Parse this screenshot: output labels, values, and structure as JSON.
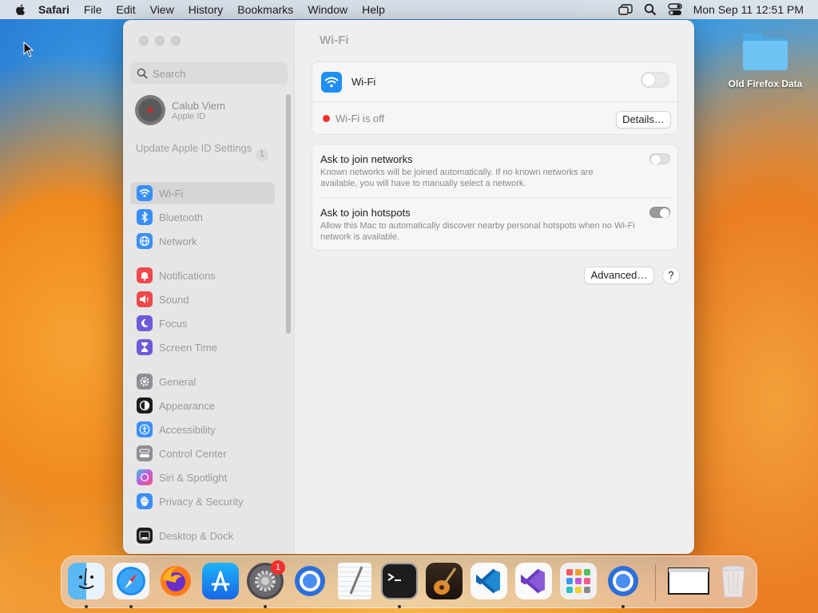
{
  "menubar": {
    "app_name": "Safari",
    "items": [
      "File",
      "Edit",
      "View",
      "History",
      "Bookmarks",
      "Window",
      "Help"
    ],
    "clock": "Mon Sep 11  12:51 PM"
  },
  "desktop": {
    "folder_label": "Old Firefox Data"
  },
  "window": {
    "search_placeholder": "Search",
    "account": {
      "name": "Calub Viem",
      "subtitle": "Apple ID"
    },
    "update": {
      "label": "Update Apple ID Settings",
      "badge": "1"
    },
    "sidebar": {
      "items": [
        {
          "label": "Wi-Fi",
          "icon": "wifi-icon",
          "color": "#3a8ff7",
          "active": true
        },
        {
          "label": "Bluetooth",
          "icon": "bluetooth-icon",
          "color": "#3a8ff7"
        },
        {
          "label": "Network",
          "icon": "network-globe-icon",
          "color": "#3a8ff7"
        },
        {
          "label": "Notifications",
          "icon": "bell-icon",
          "color": "#f0484a"
        },
        {
          "label": "Sound",
          "icon": "speaker-icon",
          "color": "#f0484a"
        },
        {
          "label": "Focus",
          "icon": "moon-icon",
          "color": "#6e5ad8"
        },
        {
          "label": "Screen Time",
          "icon": "hourglass-icon",
          "color": "#6e5ad8"
        },
        {
          "label": "General",
          "icon": "gear-icon",
          "color": "#8e8e93"
        },
        {
          "label": "Appearance",
          "icon": "appearance-icon",
          "color": "#1d1d1f"
        },
        {
          "label": "Accessibility",
          "icon": "accessibility-icon",
          "color": "#3a8ff7"
        },
        {
          "label": "Control Center",
          "icon": "control-center-icon",
          "color": "#8e8e93"
        },
        {
          "label": "Siri & Spotlight",
          "icon": "siri-icon",
          "color": "#c45bd8"
        },
        {
          "label": "Privacy & Security",
          "icon": "hand-icon",
          "color": "#3a8ff7"
        },
        {
          "label": "Desktop & Dock",
          "icon": "dock-icon",
          "color": "#1d1d1f"
        }
      ]
    },
    "main": {
      "title": "Wi-Fi",
      "wifi_label": "Wi-Fi",
      "wifi_on": false,
      "status_text": "Wi-Fi is off",
      "details_button": "Details…",
      "ask_networks": {
        "title": "Ask to join networks",
        "description": "Known networks will be joined automatically. If no known networks are available, you will have to manually select a network.",
        "on": false
      },
      "ask_hotspots": {
        "title": "Ask to join hotspots",
        "description": "Allow this Mac to automatically discover nearby personal hotspots when no Wi-Fi network is available.",
        "on": true
      },
      "advanced_button": "Advanced…",
      "help_button": "?"
    }
  },
  "dock": {
    "apps": [
      "Finder",
      "Safari",
      "Firefox",
      "App Store",
      "System Settings",
      "Chromium",
      "TextEdit",
      "Terminal",
      "Instruments",
      "Visual Studio Code",
      "Visual Studio",
      "Launchpad",
      "Chromium"
    ],
    "settings_badge": "1",
    "accent": "#f0302c"
  }
}
